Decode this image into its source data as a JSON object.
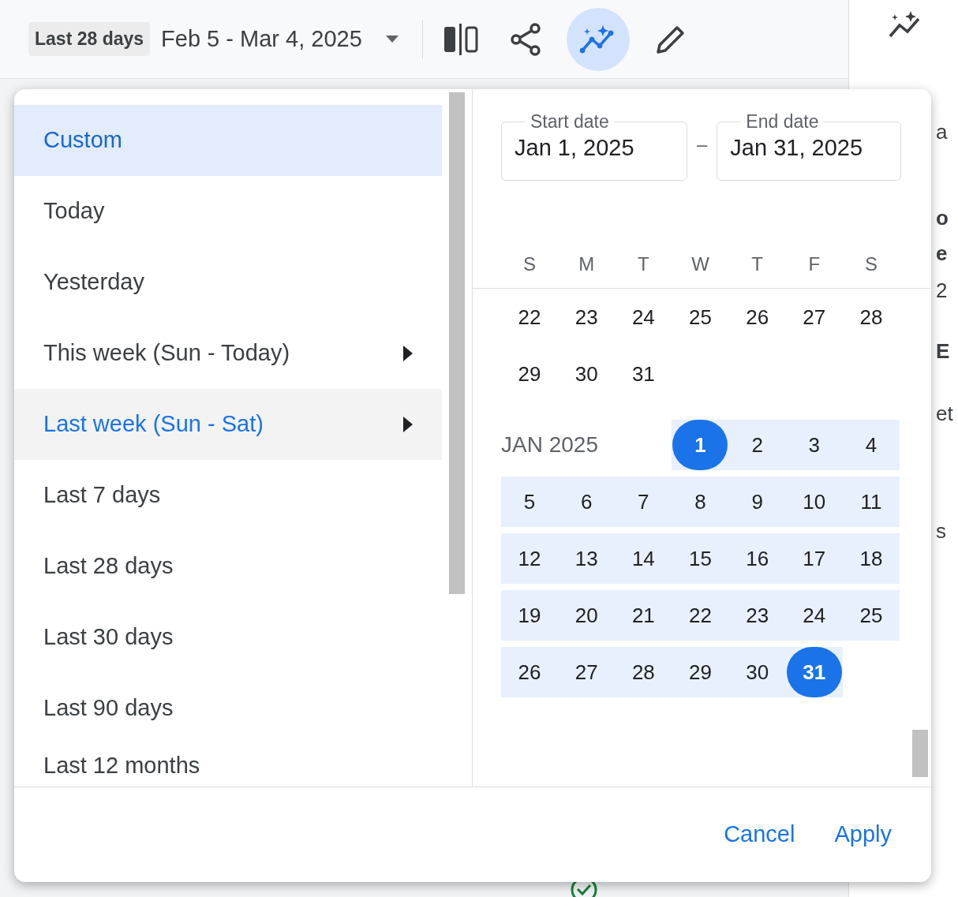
{
  "toolbar": {
    "range_chip": "Last 28 days",
    "date_range": "Feb 5 - Mar 4, 2025",
    "tools": [
      {
        "kind": "compare",
        "selected": false
      },
      {
        "kind": "share",
        "selected": false
      },
      {
        "kind": "insights",
        "selected": true
      },
      {
        "kind": "edit",
        "selected": false
      }
    ]
  },
  "presets": [
    {
      "label": "Custom",
      "selected": true,
      "highlighted": false,
      "submenu": false
    },
    {
      "label": "Today",
      "selected": false,
      "highlighted": false,
      "submenu": false
    },
    {
      "label": "Yesterday",
      "selected": false,
      "highlighted": false,
      "submenu": false
    },
    {
      "label": "This week (Sun - Today)",
      "selected": false,
      "highlighted": false,
      "submenu": true
    },
    {
      "label": "Last week (Sun - Sat)",
      "selected": false,
      "highlighted": true,
      "submenu": true
    },
    {
      "label": "Last 7 days",
      "selected": false,
      "highlighted": false,
      "submenu": false
    },
    {
      "label": "Last 28 days",
      "selected": false,
      "highlighted": false,
      "submenu": false
    },
    {
      "label": "Last 30 days",
      "selected": false,
      "highlighted": false,
      "submenu": false
    },
    {
      "label": "Last 90 days",
      "selected": false,
      "highlighted": false,
      "submenu": false
    },
    {
      "label": "Last 12 months",
      "selected": false,
      "highlighted": false,
      "submenu": false
    }
  ],
  "start_date": {
    "label": "Start date",
    "value": "Jan 1, 2025"
  },
  "separator": "–",
  "end_date": {
    "label": "End date",
    "value": "Jan 31, 2025"
  },
  "weekdays": [
    "S",
    "M",
    "T",
    "W",
    "T",
    "F",
    "S"
  ],
  "previous_weeks": [
    [
      "22",
      "23",
      "24",
      "25",
      "26",
      "27",
      "28"
    ],
    [
      "29",
      "30",
      "31"
    ]
  ],
  "month": {
    "label": "JAN 2025",
    "weeks": [
      [
        {
          "day": "1",
          "selected": true,
          "in_range": true
        },
        {
          "day": "2",
          "selected": false,
          "in_range": true
        },
        {
          "day": "3",
          "selected": false,
          "in_range": true
        },
        {
          "day": "4",
          "selected": false,
          "in_range": true
        }
      ],
      [
        {
          "day": "5",
          "selected": false,
          "in_range": true
        },
        {
          "day": "6",
          "selected": false,
          "in_range": true
        },
        {
          "day": "7",
          "selected": false,
          "in_range": true
        },
        {
          "day": "8",
          "selected": false,
          "in_range": true
        },
        {
          "day": "9",
          "selected": false,
          "in_range": true
        },
        {
          "day": "10",
          "selected": false,
          "in_range": true
        },
        {
          "day": "11",
          "selected": false,
          "in_range": true
        }
      ],
      [
        {
          "day": "12",
          "selected": false,
          "in_range": true
        },
        {
          "day": "13",
          "selected": false,
          "in_range": true
        },
        {
          "day": "14",
          "selected": false,
          "in_range": true
        },
        {
          "day": "15",
          "selected": false,
          "in_range": true
        },
        {
          "day": "16",
          "selected": false,
          "in_range": true
        },
        {
          "day": "17",
          "selected": false,
          "in_range": true
        },
        {
          "day": "18",
          "selected": false,
          "in_range": true
        }
      ],
      [
        {
          "day": "19",
          "selected": false,
          "in_range": true
        },
        {
          "day": "20",
          "selected": false,
          "in_range": true
        },
        {
          "day": "21",
          "selected": false,
          "in_range": true
        },
        {
          "day": "22",
          "selected": false,
          "in_range": true
        },
        {
          "day": "23",
          "selected": false,
          "in_range": true
        },
        {
          "day": "24",
          "selected": false,
          "in_range": true
        },
        {
          "day": "25",
          "selected": false,
          "in_range": true
        }
      ],
      [
        {
          "day": "26",
          "selected": false,
          "in_range": true
        },
        {
          "day": "27",
          "selected": false,
          "in_range": true
        },
        {
          "day": "28",
          "selected": false,
          "in_range": true
        },
        {
          "day": "29",
          "selected": false,
          "in_range": true
        },
        {
          "day": "30",
          "selected": false,
          "in_range": true
        },
        {
          "day": "31",
          "selected": true,
          "in_range": true
        }
      ]
    ]
  },
  "footer": {
    "cancel": "Cancel",
    "apply": "Apply"
  },
  "background_fragments": [
    "a",
    "o",
    "e",
    "2",
    "E",
    "et",
    "s"
  ]
}
